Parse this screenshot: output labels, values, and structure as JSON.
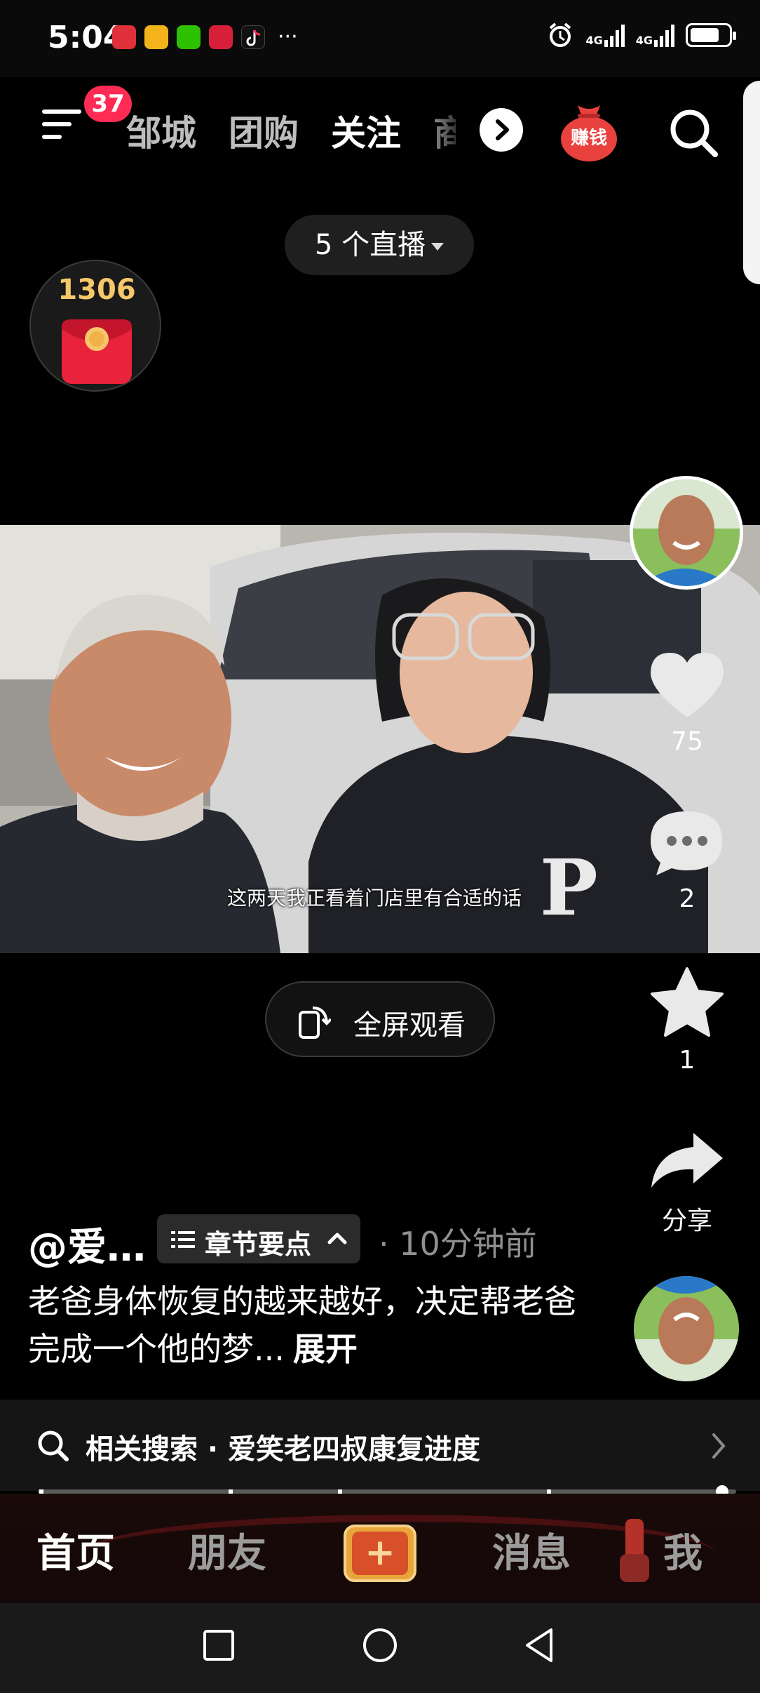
{
  "status_bar": {
    "time": "5:04",
    "network_1": "4G",
    "network_2": "4G",
    "more": "···"
  },
  "top_nav": {
    "notification_count": "37",
    "tabs": [
      {
        "label": "邹城",
        "active": false
      },
      {
        "label": "团购",
        "active": false
      },
      {
        "label": "关注",
        "active": true
      },
      {
        "label": "商城",
        "active": false
      }
    ],
    "earn_money_label": "赚钱"
  },
  "live_pill": {
    "label": "5 个直播"
  },
  "red_packet": {
    "count": "1306"
  },
  "video": {
    "subtitle": "这两天我正看着门店里有合适的话",
    "jacket_letter": "P"
  },
  "fullscreen_button": {
    "label": "全屏观看"
  },
  "actions": {
    "likes": "75",
    "comments": "2",
    "favorites": "1",
    "share_label": "分享"
  },
  "caption": {
    "author": "@爱…",
    "chapter_label": "章节要点",
    "time_ago": "· 10分钟前",
    "description": "老爸身体恢复的越来越好，决定帮老爸完成一个他的梦...",
    "expand_label": "展开"
  },
  "related_search": {
    "label": "相关搜索 · 爱笑老四叔康复进度"
  },
  "progress": {
    "value": 0.98
  },
  "bottom_nav": {
    "home": "首页",
    "friends": "朋友",
    "messages": "消息",
    "me": "我"
  },
  "colors": {
    "accent_red": "#fe2c55",
    "red_packet_gold": "#f5c86a",
    "plus_orange": "#e8a63a"
  }
}
